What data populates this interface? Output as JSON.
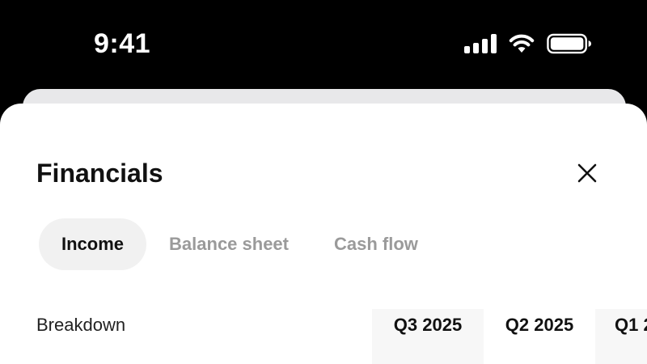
{
  "status_bar": {
    "time": "9:41",
    "icons": [
      "cellular-signal-icon",
      "wifi-icon",
      "battery-icon"
    ]
  },
  "sheet": {
    "title": "Financials",
    "close_icon": "close-icon",
    "tabs": [
      {
        "label": "Income",
        "active": true
      },
      {
        "label": "Balance sheet",
        "active": false
      },
      {
        "label": "Cash flow",
        "active": false
      }
    ],
    "table": {
      "row_header": "Breakdown",
      "columns": [
        "Q3 2025",
        "Q2 2025",
        "Q1 2"
      ]
    }
  },
  "colors": {
    "background": "#000000",
    "sheet": "#ffffff",
    "active_tab_bg": "#f1f1f1",
    "inactive_tab_text": "#9a9a9a",
    "text": "#111111"
  }
}
